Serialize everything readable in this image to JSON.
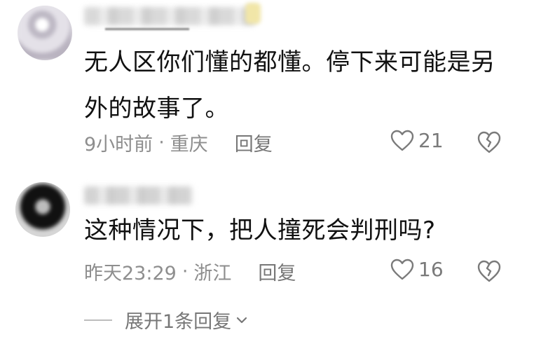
{
  "comments": [
    {
      "text": "无人区你们懂的都懂。停下来可能是另外的故事了。",
      "time": "9小时前",
      "location": "重庆",
      "reply_label": "回复",
      "likes": "21"
    },
    {
      "text": "这种情况下，把人撞死会判刑吗?",
      "time": "昨天23:29",
      "location": "浙江",
      "reply_label": "回复",
      "likes": "16"
    }
  ],
  "expand_replies": "展开1条回复",
  "separator": "·",
  "colors": {
    "text": "#111111",
    "meta": "#8e8e8e",
    "icon": "#7a7a7a"
  }
}
